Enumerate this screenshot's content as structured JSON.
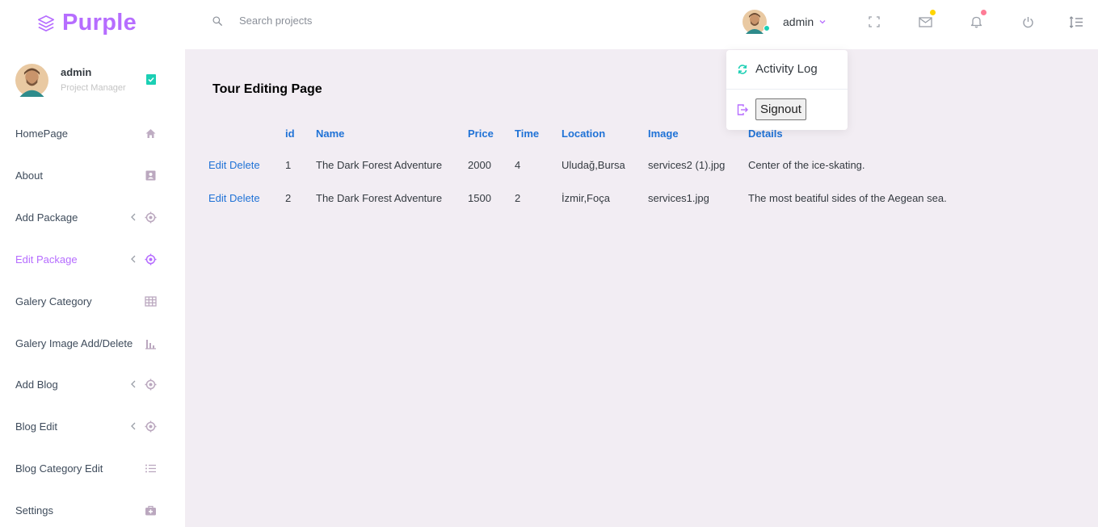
{
  "brand": {
    "name": "Purple",
    "color": "#b66dff"
  },
  "search": {
    "placeholder": "Search projects",
    "icon": "search-icon"
  },
  "navbar": {
    "user_name": "admin",
    "icons": [
      "fullscreen-icon",
      "mail-icon",
      "bell-icon",
      "power-icon",
      "menu-list-icon"
    ],
    "mail_badge_color": "#ffd500",
    "bell_badge_color": "#fe7c96"
  },
  "sidebar": {
    "profile": {
      "name": "admin",
      "role": "Project Manager"
    },
    "items": [
      {
        "label": "HomePage",
        "icon": "home-icon",
        "chevron": false,
        "active": false
      },
      {
        "label": "About",
        "icon": "contacts-icon",
        "chevron": false,
        "active": false
      },
      {
        "label": "Add Package",
        "icon": "crosshairs-icon",
        "chevron": true,
        "active": false
      },
      {
        "label": "Edit Package",
        "icon": "crosshairs-icon",
        "chevron": true,
        "active": true
      },
      {
        "label": "Galery Category",
        "icon": "table-icon",
        "chevron": false,
        "active": false
      },
      {
        "label": "Galery Image Add/Delete",
        "icon": "bar-chart-icon",
        "chevron": false,
        "active": false
      },
      {
        "label": "Add Blog",
        "icon": "crosshairs-icon",
        "chevron": true,
        "active": false
      },
      {
        "label": "Blog Edit",
        "icon": "crosshairs-icon",
        "chevron": true,
        "active": false
      },
      {
        "label": "Blog Category Edit",
        "icon": "list-icon",
        "chevron": false,
        "active": false
      },
      {
        "label": "Settings",
        "icon": "medical-bag-icon",
        "chevron": false,
        "active": false
      }
    ]
  },
  "main": {
    "title": "Tour Editing Page",
    "table": {
      "columns": [
        "",
        "id",
        "Name",
        "Price",
        "Time",
        "Location",
        "Image",
        "Details"
      ],
      "rows": [
        {
          "edit": "Edit",
          "delete": "Delete",
          "id": "1",
          "name": "The Dark Forest Adventure",
          "price": "2000",
          "time": "4",
          "location": "Uludağ,Bursa",
          "image": "services2 (1).jpg",
          "details": "Center of the ice-skating."
        },
        {
          "edit": "Edit",
          "delete": "Delete",
          "id": "2",
          "name": "The Dark Forest Adventure",
          "price": "1500",
          "time": "2",
          "location": "İzmir,Foça",
          "image": "services1.jpg",
          "details": "The most beatiful sides of the Aegean sea."
        }
      ]
    }
  },
  "dropdown": {
    "activity_log": "Activity Log",
    "signout": "Signout"
  }
}
